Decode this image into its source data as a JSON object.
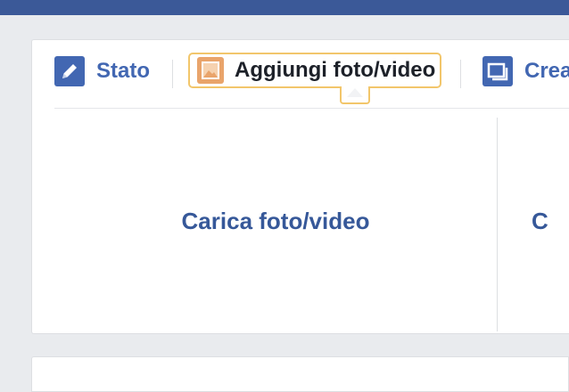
{
  "composer": {
    "tabs": [
      {
        "label": "Stato",
        "icon": "pencil-icon"
      },
      {
        "label": "Aggiungi foto/video",
        "icon": "photo-icon"
      },
      {
        "label": "Crea",
        "icon": "album-icon"
      }
    ],
    "upload_label": "Carica foto/video",
    "next_label": "C"
  },
  "colors": {
    "header": "#3b5998",
    "link_blue": "#4267b2",
    "highlight": "#f2c66b",
    "photo_icon": "#e9a46b"
  }
}
